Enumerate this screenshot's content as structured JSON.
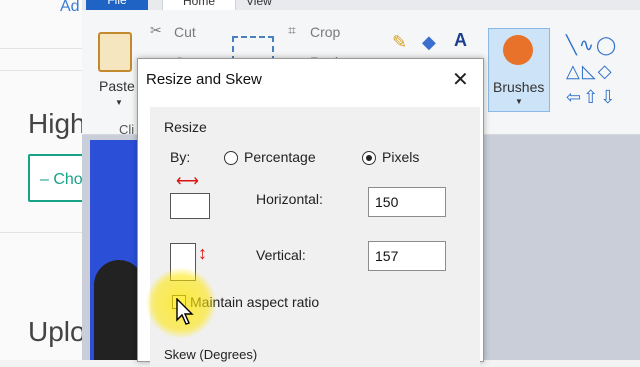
{
  "background_page": {
    "link_text": "Ad",
    "heading_1": "High",
    "choose_button": "– Cho",
    "heading_2": "Uplo"
  },
  "paint": {
    "menu": {
      "file": "File",
      "home": "Home",
      "view": "View"
    },
    "ribbon": {
      "paste_label": "Paste",
      "clipboard_label": "Cli",
      "cut_label": "Cut",
      "copy_label": "Co",
      "crop_label": "Crop",
      "resize_label": "Resize",
      "brushes_label": "Brushes",
      "text_tool": "A"
    }
  },
  "dialog": {
    "title": "Resize and Skew",
    "resize_group": "Resize",
    "by_label": "By:",
    "percentage_label": "Percentage",
    "pixels_label": "Pixels",
    "selected_unit": "Pixels",
    "horizontal_label": "Horizontal:",
    "horizontal_value": "150",
    "vertical_label": "Vertical:",
    "vertical_value": "157",
    "maintain_label": "Maintain aspect ratio",
    "maintain_checked": false,
    "skew_group": "Skew (Degrees)"
  },
  "colors": {
    "accent": "#1f63c4",
    "teal": "#17a386",
    "dialog_bg": "#f0f0f0"
  }
}
